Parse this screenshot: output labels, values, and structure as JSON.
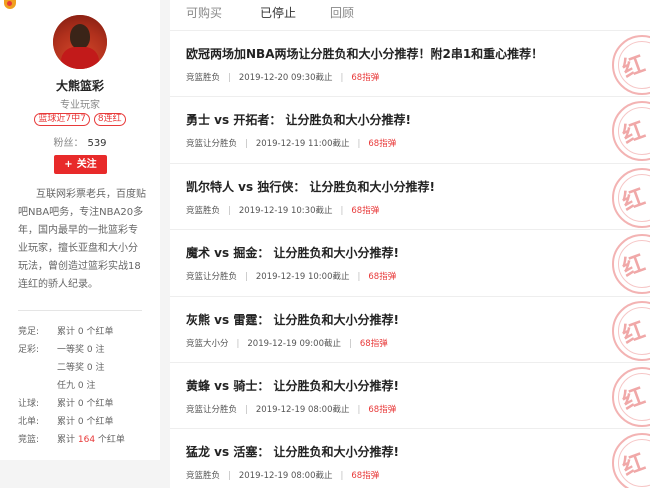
{
  "profile": {
    "name": "大熊篮彩",
    "role": "专业玩家",
    "badges": [
      "篮球近7中7",
      "8连红"
    ],
    "fans_label": "粉丝：",
    "fans_count": "539",
    "follow_label": "关注",
    "bio": "互联网彩票老兵，百度贴吧NBA吧务，专注NBA20多年，国内最早的一批篮彩专业玩家，擅长亚盘和大小分玩法，曾创造过篮彩实战18连红的骄人纪录。"
  },
  "stats": [
    {
      "cat": "竞足:",
      "pre": "累计 ",
      "num": "0",
      "post": " 个红单"
    },
    {
      "cat": "足彩:",
      "pre": "一等奖 ",
      "num": "0",
      "post": " 注"
    },
    {
      "cat": "",
      "pre": "二等奖 ",
      "num": "0",
      "post": " 注"
    },
    {
      "cat": "",
      "pre": "任九 ",
      "num": "0",
      "post": " 注"
    },
    {
      "cat": "让球:",
      "pre": "累计 ",
      "num": "0",
      "post": " 个红单"
    },
    {
      "cat": "北单:",
      "pre": "累计 ",
      "num": "0",
      "post": " 个红单"
    },
    {
      "cat": "竞篮:",
      "pre": "累计 ",
      "num": "164",
      "post": " 个红单"
    }
  ],
  "tabs": [
    "可购买",
    "已停止",
    "回顾"
  ],
  "active_tab": "已停止",
  "articles": [
    {
      "title": "欧冠两场加NBA两场让分胜负和大小分推荐！附2串1和重心推荐！",
      "category": "竞篮胜负",
      "time": "2019-12-20 09:30截止",
      "popularity": "68指弹"
    },
    {
      "title": "勇士 vs 开拓者： 让分胜负和大小分推荐!",
      "category": "竞篮让分胜负",
      "time": "2019-12-19 11:00截止",
      "popularity": "68指弹"
    },
    {
      "title": "凯尔特人 vs 独行侠： 让分胜负和大小分推荐!",
      "category": "竞篮胜负",
      "time": "2019-12-19 10:30截止",
      "popularity": "68指弹"
    },
    {
      "title": "魔术 vs 掘金： 让分胜负和大小分推荐!",
      "category": "竞篮让分胜负",
      "time": "2019-12-19 10:00截止",
      "popularity": "68指弹"
    },
    {
      "title": "灰熊 vs 雷霆： 让分胜负和大小分推荐!",
      "category": "竞篮大小分",
      "time": "2019-12-19 09:00截止",
      "popularity": "68指弹"
    },
    {
      "title": "黄蜂 vs 骑士： 让分胜负和大小分推荐!",
      "category": "竞篮让分胜负",
      "time": "2019-12-19 08:00截止",
      "popularity": "68指弹"
    },
    {
      "title": "猛龙 vs 活塞： 让分胜负和大小分推荐!",
      "category": "竞篮胜负",
      "time": "2019-12-19 08:00截止",
      "popularity": "68指弹"
    }
  ],
  "stamp_glyph": "红",
  "colors": {
    "accent": "#e82a2a",
    "stamp": "#f0a8a8"
  }
}
